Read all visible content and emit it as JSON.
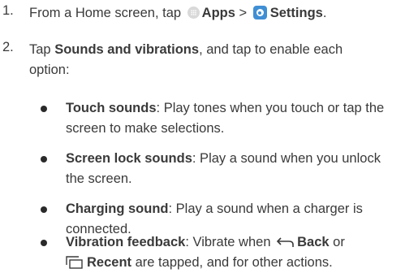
{
  "steps": [
    {
      "number": "1.",
      "pre": "From a Home screen, tap",
      "apps_label": "Apps",
      "separator": ">",
      "settings_label": "Settings",
      "post": "."
    },
    {
      "number": "2.",
      "pre": "Tap",
      "bold": "Sounds and vibrations",
      "post": ", and tap to enable each option:"
    }
  ],
  "options": [
    {
      "title": "Touch sounds",
      "desc": ": Play tones when you touch or tap the screen to make selections."
    },
    {
      "title": "Screen lock sounds",
      "desc": ": Play a sound when you unlock the screen."
    },
    {
      "title": "Charging sound",
      "desc": ": Play a sound when a charger is connected."
    },
    {
      "title": "Vibration feedback",
      "desc_pre": ": Vibrate when",
      "back_label": "Back",
      "mid": "or",
      "recent_label": "Recent",
      "desc_post": "are tapped, and for other actions."
    }
  ],
  "icons": {
    "apps": "apps-icon",
    "settings": "settings-icon",
    "back": "back-icon",
    "recent": "recent-icon"
  },
  "colors": {
    "text": "#3a3a3a",
    "settings_icon": "#3f8fd4",
    "apps_icon": "#d9d9d9"
  }
}
